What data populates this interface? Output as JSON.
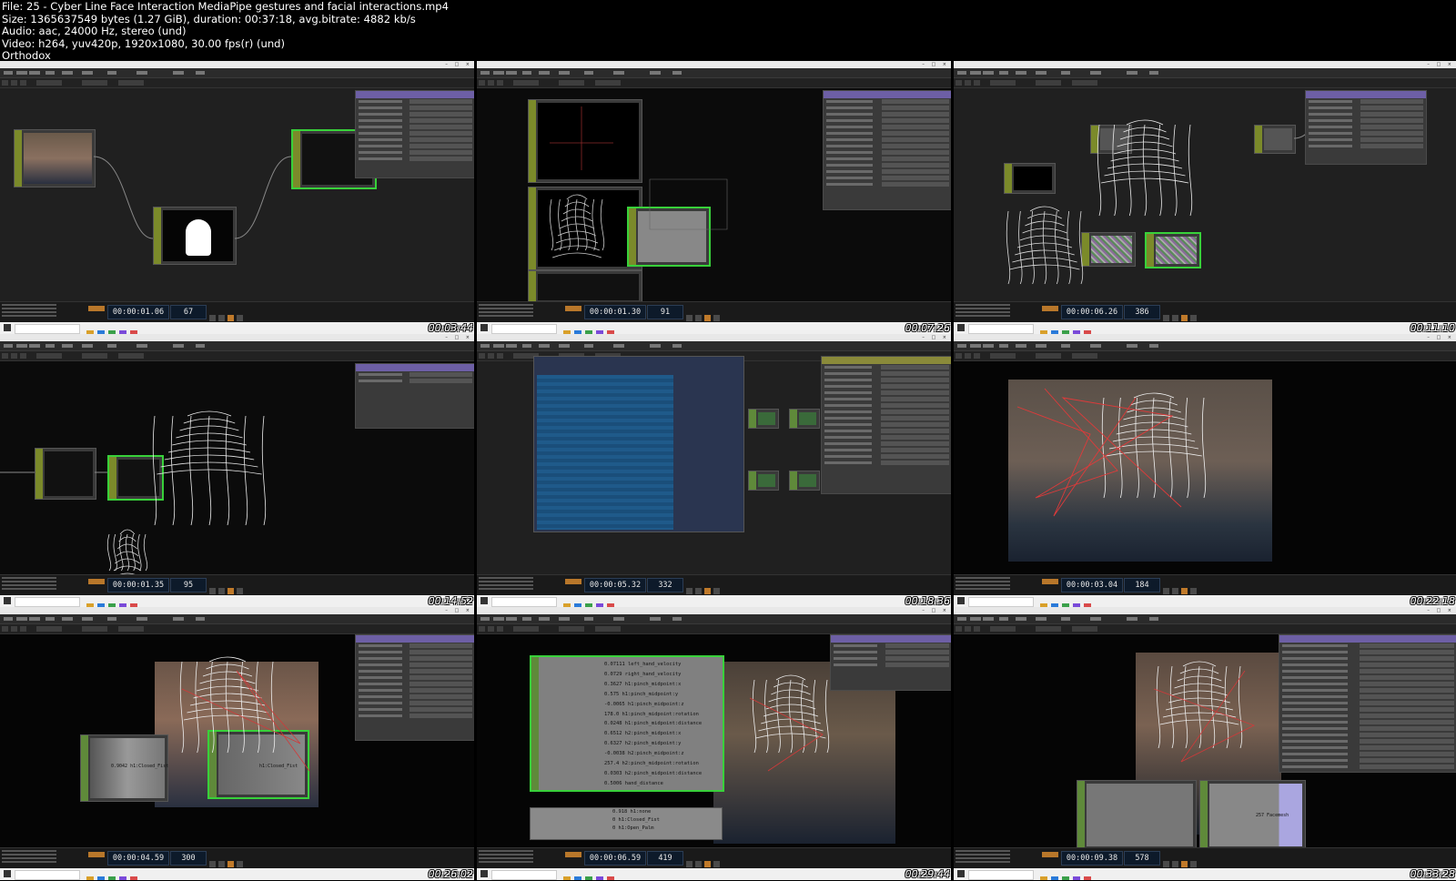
{
  "header": {
    "line1": "File: 25 - Cyber Line Face Interaction MediaPipe gestures and facial interactions.mp4",
    "line2": "Size: 1365637549 bytes (1.27 GiB), duration: 00:37:18, avg.bitrate: 4882 kb/s",
    "line3": "Audio: aac, 24000 Hz, stereo (und)",
    "line4": "Video: h264, yuv420p, 1920x1080, 30.00 fps(r) (und)",
    "line5": "Orthodox"
  },
  "thumbnails": [
    {
      "timecode": "00:00:01.06",
      "frame": "67",
      "stamp": "00:03:44"
    },
    {
      "timecode": "00:00:01.30",
      "frame": "91",
      "stamp": "00:07:26"
    },
    {
      "timecode": "00:00:06.26",
      "frame": "386",
      "stamp": "00:11:10"
    },
    {
      "timecode": "00:00:01.35",
      "frame": "95",
      "stamp": "00:14:52"
    },
    {
      "timecode": "00:00:05.32",
      "frame": "332",
      "stamp": "00:18:36"
    },
    {
      "timecode": "00:00:03.04",
      "frame": "184",
      "stamp": "00:22:18"
    },
    {
      "timecode": "00:00:04.59",
      "frame": "300",
      "stamp": "00:26:02"
    },
    {
      "timecode": "00:00:06.59",
      "frame": "419",
      "stamp": "00:29:44"
    },
    {
      "timecode": "00:00:09.38",
      "frame": "578",
      "stamp": "00:33:28"
    }
  ],
  "thumb8_values": [
    "0.07111 left_hand_velocity",
    "0.0729 right_hand_velocity",
    "0.3627 h1:pinch_midpoint:x",
    "0.575 h1:pinch_midpoint:y",
    "-0.0065 h1:pinch_midpoint:z",
    "178.0 h1:pinch_midpoint:rotation",
    "0.0248 h1:pinch_midpoint:distance",
    "0.6512 h2:pinch_midpoint:x",
    "0.6327 h2:pinch_midpoint:y",
    "-0.0038 h2:pinch_midpoint:z",
    "257.4 h2:pinch_midpoint:rotation",
    "0.0303 h2:pinch_midpoint:distance",
    "0.5006 hand_distance"
  ],
  "thumb8_lower": [
    "0.918 h1:none",
    "0 h1:Closed_Fist",
    "0 h1:Open_Palm"
  ],
  "thumb7_labels": [
    "0.9042 h1:Closed_Fist",
    "h1:Closed_Fist"
  ],
  "thumb9_label": "257 Facemesh",
  "colors": {
    "selected_outline": "#38d13a",
    "top_node": "#6e5b9a",
    "chop_node": "#5f8a3a",
    "timecode_bg": "#0d1a2a",
    "play_button": "#c07a2a"
  }
}
